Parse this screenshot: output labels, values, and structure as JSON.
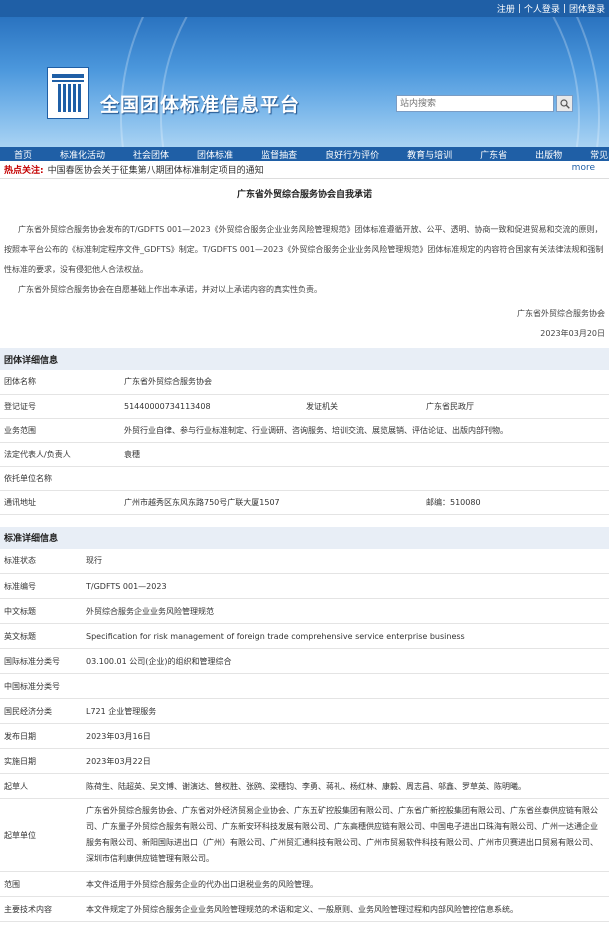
{
  "topbar": {
    "register": "注册",
    "personal_login": "个人登录",
    "group_login": "团体登录",
    "separator": "|"
  },
  "header": {
    "site_title": "全国团体标准信息平台",
    "search_placeholder": "站内搜索",
    "search_icon": "search-icon",
    "colors": {
      "primary": "#1f5fa6",
      "hot": "#c40000"
    }
  },
  "nav": {
    "items": [
      "首页",
      "标准化活动",
      "社会团体",
      "团体标准",
      "监督抽查",
      "良好行为评价",
      "教育与培训",
      "广东省",
      "出版物",
      "常见问题"
    ]
  },
  "hotnews": {
    "label": "热点关注:",
    "text": "中国春医协会关于征集第八期团体标准制定项目的通知",
    "more": "more"
  },
  "notice": {
    "title": "广东省外贸综合服务协会自我承诺",
    "paragraph1": "广东省外贸综合服务协会发布的T/GDFTS 001—2023《外贸综合服务企业业务风险管理规范》团体标准遵循开放、公平、透明、协商一致和促进贸易和交流的原则，按照本平台公布的《标准制定程序文件_GDFTS》制定。T/GDFTS 001—2023《外贸综合服务企业业务风险管理规范》团体标准规定的内容符合国家有关法律法规和强制性标准的要求，没有侵犯他人合法权益。",
    "paragraph2": "广东省外贸综合服务协会在自愿基础上作出本承诺，并对以上承诺内容的真实性负责。",
    "signer": "广东省外贸综合服务协会",
    "date": "2023年03月20日"
  },
  "org": {
    "section_title": "团体详细信息",
    "name_label": "团体名称",
    "name_value": "广东省外贸综合服务协会",
    "reg_label": "登记证号",
    "reg_value": "51440000734113408",
    "issuer_label": "发证机关",
    "issuer_value": "广东省民政厅",
    "scope_label": "业务范围",
    "scope_value": "外贸行业自律、参与行业标准制定、行业调研、咨询服务、培训交流、展览展销、评估论证、出版内部刊物。",
    "rep_label": "法定代表人/负责人",
    "rep_value": "袁穗",
    "dep_label": "依托单位名称",
    "dep_value": "",
    "addr_label": "通讯地址",
    "addr_value": "广州市越秀区东风东路750号广联大厦1507",
    "postcode": "邮编：510080"
  },
  "standard": {
    "section_title": "标准详细信息",
    "rows": [
      {
        "label": "标准状态",
        "value": "现行"
      },
      {
        "label": "标准编号",
        "value": "T/GDFTS 001—2023"
      },
      {
        "label": "中文标题",
        "value": "外贸综合服务企业业务风险管理规范"
      },
      {
        "label": "英文标题",
        "value": "Specification for risk management of foreign trade comprehensive service enterprise business"
      },
      {
        "label": "国际标准分类号",
        "value": "03.100.01 公司(企业)的组织和管理综合"
      },
      {
        "label": "中国标准分类号",
        "value": ""
      },
      {
        "label": "国民经济分类",
        "value": "L721 企业管理服务"
      },
      {
        "label": "发布日期",
        "value": "2023年03月16日"
      },
      {
        "label": "实施日期",
        "value": "2023年03月22日"
      },
      {
        "label": "起草人",
        "value": "陈荷生、陆超英、吴文博、谢演达、曾权胜、张鸥、梁穗钧、李勇、蒋礼、杨红林、康毅、周志昌、邬鑫、罗草英、陈明曦。"
      },
      {
        "label": "起草单位",
        "value": "广东省外贸综合服务协会、广东省对外经济贸易企业协会、广东五矿控股集团有限公司、广东省广新控股集团有限公司、广东省丝泰供应链有限公司、广东量子外贸综合服务有限公司、广东新安环科技发展有限公司、广东高穗供应链有限公司、中国电子进出口珠海有限公司、广州一达通企业服务有限公司、新阳国际进出口（广州）有限公司、广州贸汇通科技有限公司、广州市贸易软件科技有限公司、广州市贝赛进出口贸易有限公司、深圳市信利康供应链管理有限公司。"
      },
      {
        "label": "范围",
        "value": "本文件适用于外贸综合服务企业的代办出口退税业务的风险管理。"
      },
      {
        "label": "主要技术内容",
        "value": "本文件规定了外贸综合服务企业业务风险管理规范的术语和定义、一般原则、业务风险管理过程和内部风险管控信息系统。"
      }
    ]
  }
}
